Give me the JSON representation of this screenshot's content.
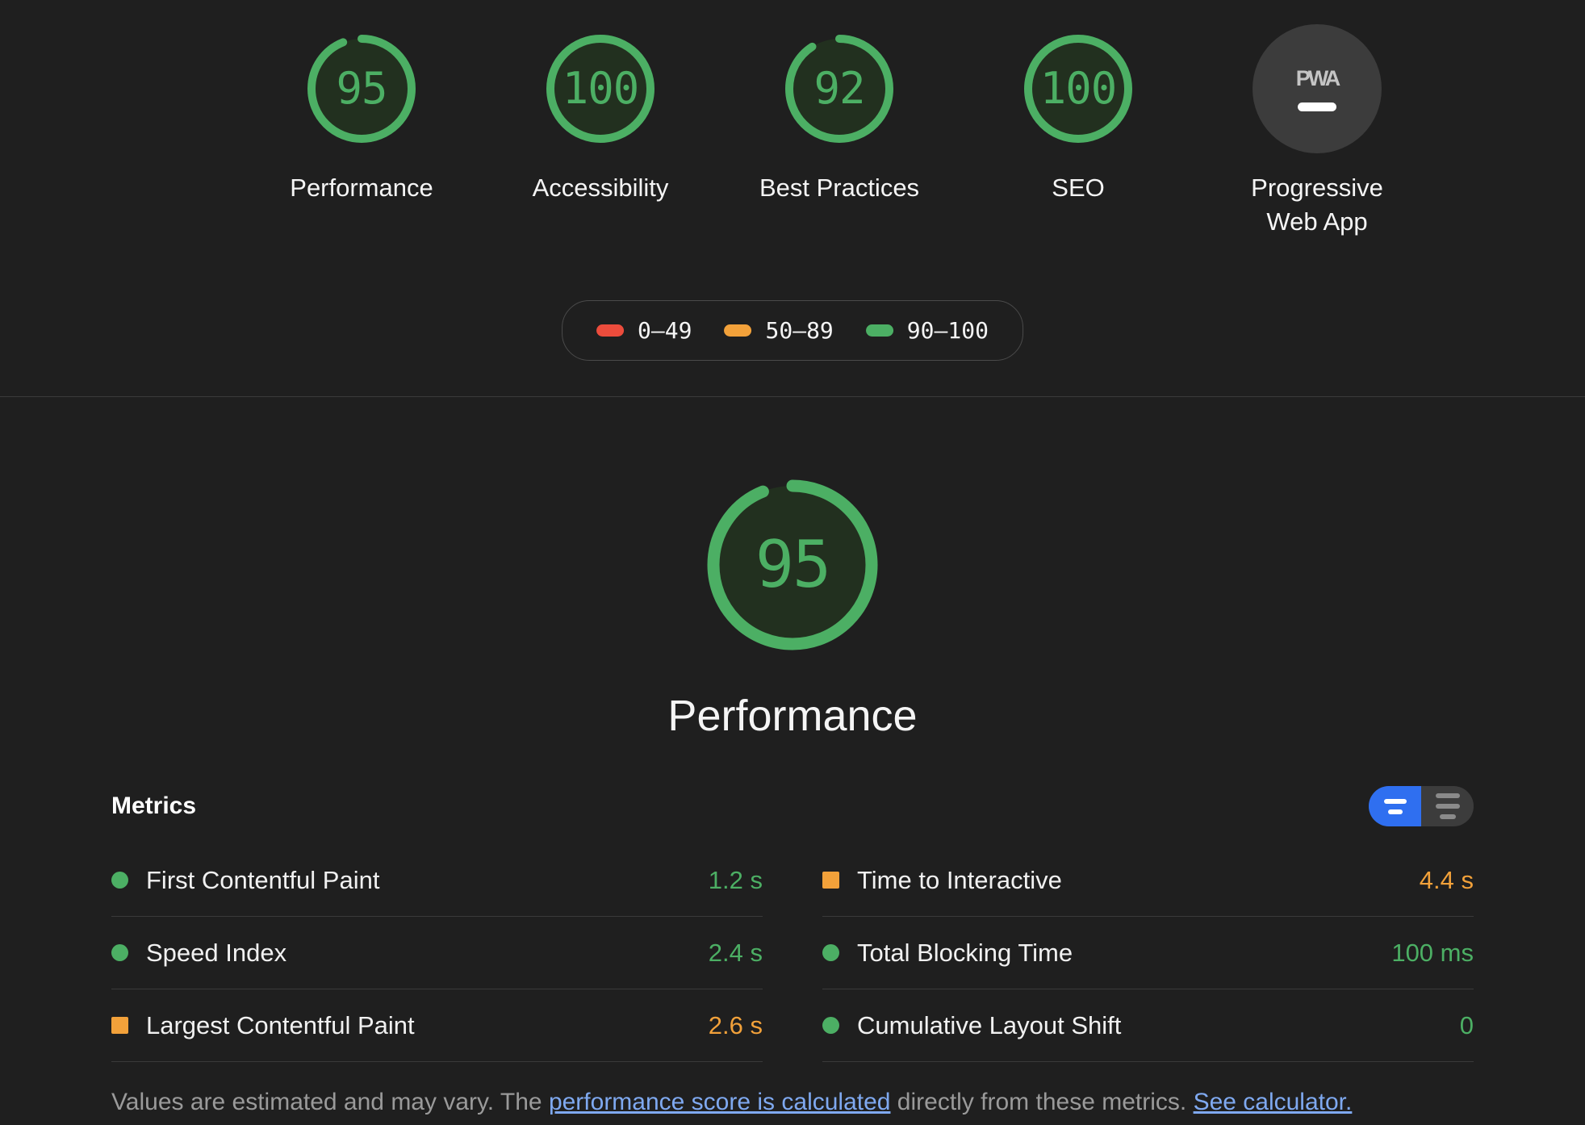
{
  "colors": {
    "pass": "#4caf64",
    "average": "#f2a13a",
    "fail": "#ec4c3c",
    "pass_bg": "#22301f",
    "neutral": "#3c3c3c",
    "accent_blue": "#2f6ff0",
    "link_blue": "#7fa9f0",
    "page_bg": "#1f1f1f",
    "text": "#f5f5f5",
    "muted": "#9a9a9a"
  },
  "score_gauges": [
    {
      "label": "Performance",
      "score": "95",
      "value": 95,
      "rating": "pass",
      "type": "gauge"
    },
    {
      "label": "Accessibility",
      "score": "100",
      "value": 100,
      "rating": "pass",
      "type": "gauge"
    },
    {
      "label": "Best Practices",
      "score": "92",
      "value": 92,
      "rating": "pass",
      "type": "gauge"
    },
    {
      "label": "SEO",
      "score": "100",
      "value": 100,
      "rating": "pass",
      "type": "gauge"
    },
    {
      "label": "Progressive Web App",
      "score": "",
      "value": null,
      "rating": "null",
      "type": "badge",
      "badge_text": "PWA"
    }
  ],
  "legend": {
    "items": [
      {
        "range": "0–49",
        "rating": "fail",
        "color": "#ec4c3c"
      },
      {
        "range": "50–89",
        "rating": "average",
        "color": "#f2a13a"
      },
      {
        "range": "90–100",
        "rating": "pass",
        "color": "#4caf64"
      }
    ]
  },
  "category": {
    "title": "Performance",
    "score": "95",
    "value": 95,
    "rating": "pass"
  },
  "metrics": {
    "heading": "Metrics",
    "toggle": {
      "simple_label": "simple-view",
      "expanded_label": "expanded-view",
      "active": "simple"
    },
    "items": [
      {
        "label": "First Contentful Paint",
        "value": "1.2 s",
        "rating": "pass",
        "marker": "circle",
        "color": "#4caf64"
      },
      {
        "label": "Time to Interactive",
        "value": "4.4 s",
        "rating": "average",
        "marker": "square",
        "color": "#f2a13a"
      },
      {
        "label": "Speed Index",
        "value": "2.4 s",
        "rating": "pass",
        "marker": "circle",
        "color": "#4caf64"
      },
      {
        "label": "Total Blocking Time",
        "value": "100 ms",
        "rating": "pass",
        "marker": "circle",
        "color": "#4caf64"
      },
      {
        "label": "Largest Contentful Paint",
        "value": "2.6 s",
        "rating": "average",
        "marker": "square",
        "color": "#f2a13a"
      },
      {
        "label": "Cumulative Layout Shift",
        "value": "0",
        "rating": "pass",
        "marker": "circle",
        "color": "#4caf64"
      }
    ],
    "footer": {
      "text_before": "Values are estimated and may vary. The ",
      "link1": "performance score is calculated",
      "text_middle": " directly from these metrics. ",
      "link2": "See calculator."
    }
  }
}
